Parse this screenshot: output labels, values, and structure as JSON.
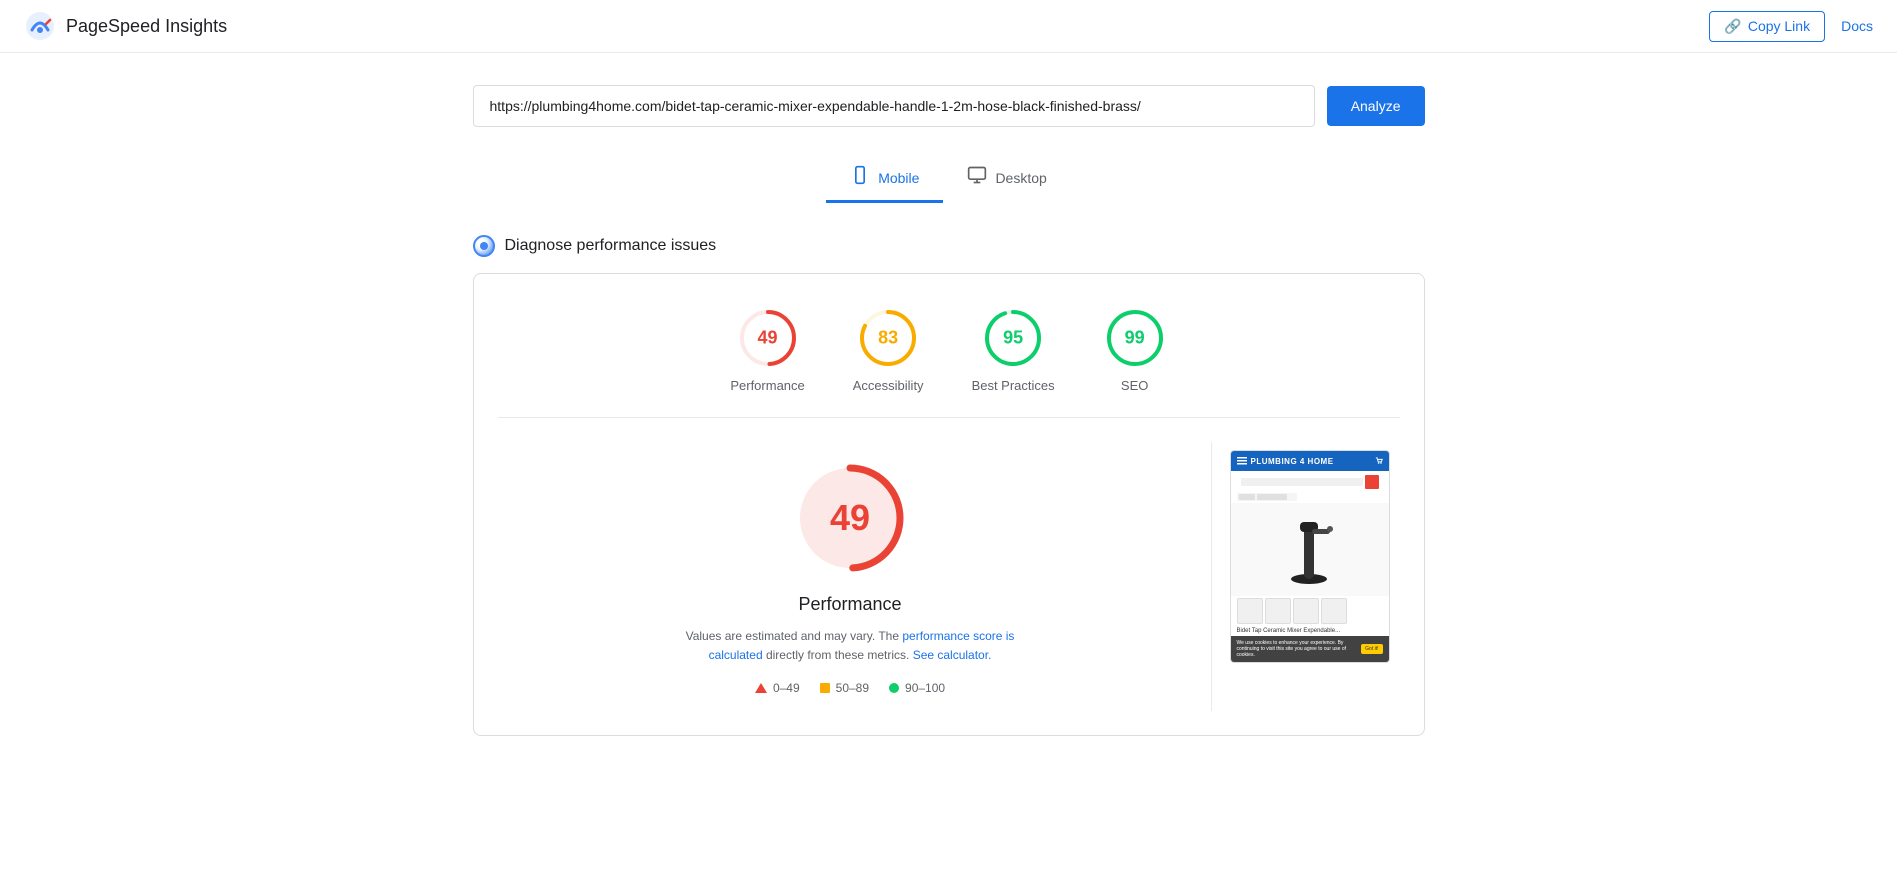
{
  "header": {
    "logo_alt": "PageSpeed Insights logo",
    "title": "PageSpeed Insights",
    "copy_link_label": "Copy Link",
    "docs_label": "Docs"
  },
  "url_bar": {
    "value": "https://plumbing4home.com/bidet-tap-ceramic-mixer-expendable-handle-1-2m-hose-black-finished-brass/",
    "analyze_label": "Analyze"
  },
  "tabs": [
    {
      "id": "mobile",
      "label": "Mobile",
      "active": true
    },
    {
      "id": "desktop",
      "label": "Desktop",
      "active": false
    }
  ],
  "section": {
    "title": "Diagnose performance issues"
  },
  "scores": [
    {
      "id": "performance",
      "value": 49,
      "label": "Performance",
      "color": "#ea4335",
      "bg_color": "#fce8e6",
      "circumference": 163,
      "offset": 83
    },
    {
      "id": "accessibility",
      "value": 83,
      "label": "Accessibility",
      "color": "#f9ab00",
      "bg_color": "#fef7e0",
      "circumference": 163,
      "offset": 28
    },
    {
      "id": "best-practices",
      "value": 95,
      "label": "Best Practices",
      "color": "#0cce6b",
      "bg_color": "#e6f4ea",
      "circumference": 163,
      "offset": 8
    },
    {
      "id": "seo",
      "value": 99,
      "label": "SEO",
      "color": "#0cce6b",
      "bg_color": "#e6f4ea",
      "circumference": 163,
      "offset": 2
    }
  ],
  "detail": {
    "big_score": 49,
    "big_score_label": "Performance",
    "description_static": "Values are estimated and may vary. The",
    "description_link1_text": "performance score is calculated",
    "description_link1_href": "#",
    "description_static2": "directly from these metrics.",
    "description_link2_text": "See calculator.",
    "description_link2_href": "#"
  },
  "legend": [
    {
      "type": "triangle",
      "range": "0–49"
    },
    {
      "type": "square",
      "range": "50–89"
    },
    {
      "type": "circle",
      "range": "90–100"
    }
  ],
  "preview": {
    "site_name": "PLUMBING 4 HOME",
    "cookie_text": "We use cookies to enhance your experience. By continuing to visit this site you agree to our use of cookies.",
    "cookie_btn": "Got it!",
    "product_title": "Bidet Tap Ceramic Mixer Expendable..."
  }
}
